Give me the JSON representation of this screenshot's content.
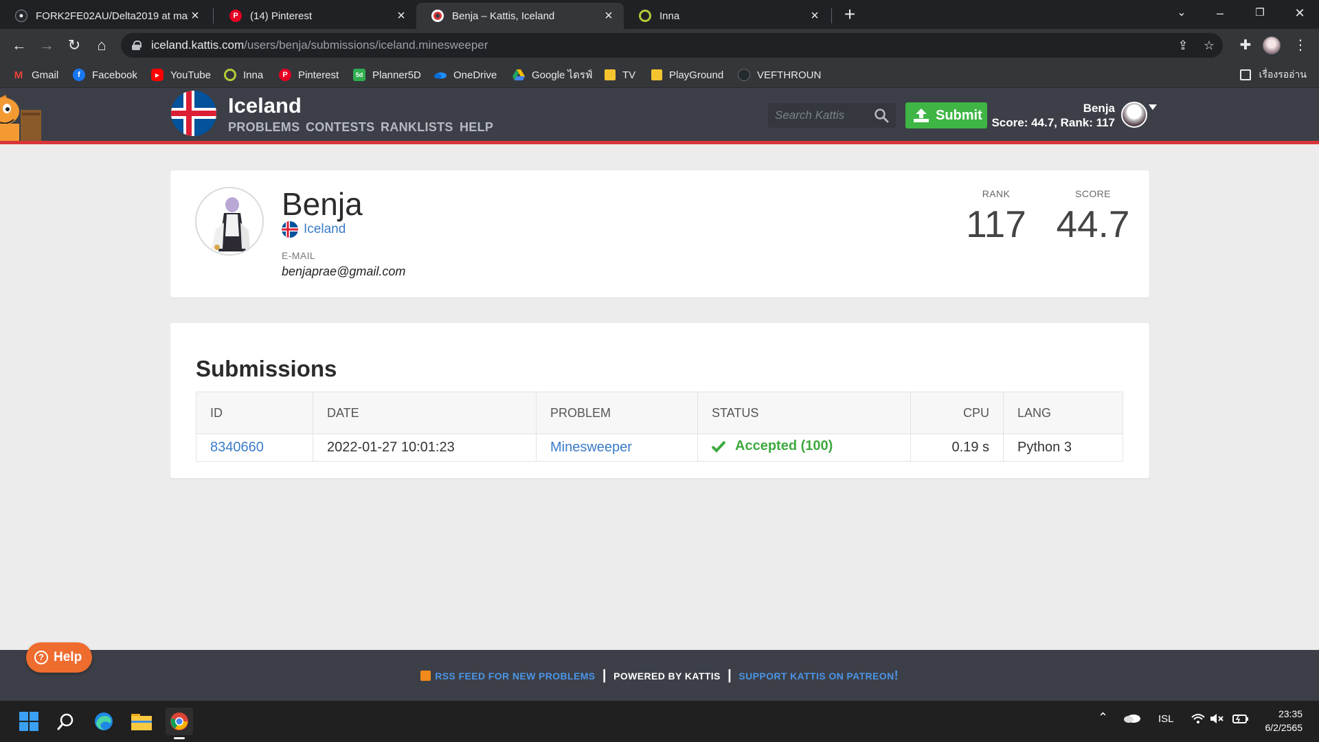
{
  "browser": {
    "tabs": [
      {
        "title": "FORK2FE02AU/Delta2019 at mai",
        "icon": "github-icon"
      },
      {
        "title": "(14) Pinterest",
        "icon": "pinterest-icon"
      },
      {
        "title": "Benja – Kattis, Iceland",
        "icon": "kattis-icon",
        "active": true
      },
      {
        "title": "Inna",
        "icon": "inna-icon"
      }
    ],
    "url_host": "iceland.kattis.com",
    "url_path": "/users/benja/submissions/iceland.minesweeper",
    "bookmarks": [
      {
        "label": "Gmail",
        "icon": "gmail-icon"
      },
      {
        "label": "Facebook",
        "icon": "facebook-icon"
      },
      {
        "label": "YouTube",
        "icon": "youtube-icon"
      },
      {
        "label": "Inna",
        "icon": "inna-icon"
      },
      {
        "label": "Pinterest",
        "icon": "pinterest-icon"
      },
      {
        "label": "Planner5D",
        "icon": "planner5d-icon"
      },
      {
        "label": "OneDrive",
        "icon": "onedrive-icon"
      },
      {
        "label": "Google ไดรฟ์",
        "icon": "google-drive-icon"
      },
      {
        "label": "TV",
        "icon": "folder-icon"
      },
      {
        "label": "PlayGround",
        "icon": "folder-icon"
      },
      {
        "label": "VEFTHROUN",
        "icon": "github-icon"
      }
    ],
    "reading_list": "เรื่องรออ่าน"
  },
  "kattis": {
    "brand": "Iceland",
    "nav": [
      "PROBLEMS",
      "CONTESTS",
      "RANKLISTS",
      "HELP"
    ],
    "search_placeholder": "Search Kattis",
    "submit_label": "Submit",
    "user_name": "Benja",
    "user_stats": "Score: 44.7, Rank: 117"
  },
  "profile": {
    "name": "Benja",
    "country": "Iceland",
    "email_label": "E-MAIL",
    "email": "benjaprae@gmail.com",
    "rank_label": "RANK",
    "rank": "117",
    "score_label": "SCORE",
    "score": "44.7"
  },
  "submissions": {
    "title": "Submissions",
    "columns": [
      "ID",
      "DATE",
      "PROBLEM",
      "STATUS",
      "CPU",
      "LANG"
    ],
    "rows": [
      {
        "id": "8340660",
        "date": "2022-01-27 10:01:23",
        "problem": "Minesweeper",
        "status": "Accepted (100)",
        "cpu": "0.19 s",
        "lang": "Python 3"
      }
    ]
  },
  "footer": {
    "rss": "RSS FEED FOR NEW PROBLEMS",
    "powered": "POWERED BY KATTIS",
    "patreon": "SUPPORT KATTIS ON PATREON",
    "patreon_bang": "!"
  },
  "help_label": "Help",
  "taskbar": {
    "lang": "ISL",
    "time": "23:35",
    "date": "6/2/2565"
  },
  "colors": {
    "header_bg": "#3c3f47",
    "accent_red": "#d9363b",
    "submit_green": "#3fb545",
    "link_blue": "#3a7bc8",
    "help_orange": "#ef6c2f"
  }
}
